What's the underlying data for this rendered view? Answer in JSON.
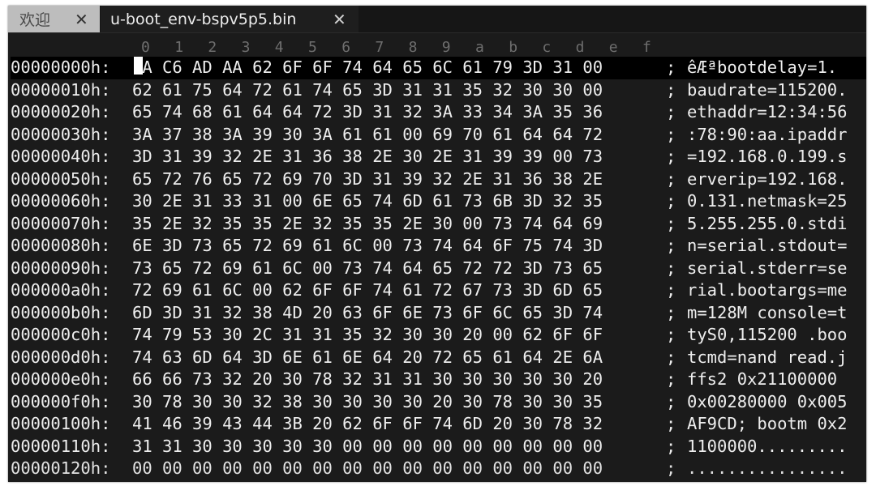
{
  "tabs": [
    {
      "label": "欢迎",
      "close": "✕"
    },
    {
      "label": "u-boot_env-bspv5p5.bin",
      "close": "✕"
    }
  ],
  "ruler": [
    "0",
    "1",
    "2",
    "3",
    "4",
    "5",
    "6",
    "7",
    "8",
    "9",
    "a",
    "b",
    "c",
    "d",
    "e",
    "f"
  ],
  "rows": [
    {
      "offset": "00000000h:",
      "hex": " A C6 AD AA 62 6F 6F 74 64 65 6C 61 79 3D 31 00",
      "sep": ";",
      "ascii": "êÆªbootdelay=1."
    },
    {
      "offset": "00000010h:",
      "hex": "62 61 75 64 72 61 74 65 3D 31 31 35 32 30 30 00",
      "sep": ";",
      "ascii": "baudrate=115200."
    },
    {
      "offset": "00000020h:",
      "hex": "65 74 68 61 64 64 72 3D 31 32 3A 33 34 3A 35 36",
      "sep": ";",
      "ascii": "ethaddr=12:34:56"
    },
    {
      "offset": "00000030h:",
      "hex": "3A 37 38 3A 39 30 3A 61 61 00 69 70 61 64 64 72",
      "sep": ";",
      "ascii": ":78:90:aa.ipaddr"
    },
    {
      "offset": "00000040h:",
      "hex": "3D 31 39 32 2E 31 36 38 2E 30 2E 31 39 39 00 73",
      "sep": ";",
      "ascii": "=192.168.0.199.s"
    },
    {
      "offset": "00000050h:",
      "hex": "65 72 76 65 72 69 70 3D 31 39 32 2E 31 36 38 2E",
      "sep": ";",
      "ascii": "erverip=192.168."
    },
    {
      "offset": "00000060h:",
      "hex": "30 2E 31 33 31 00 6E 65 74 6D 61 73 6B 3D 32 35",
      "sep": ";",
      "ascii": "0.131.netmask=25"
    },
    {
      "offset": "00000070h:",
      "hex": "35 2E 32 35 35 2E 32 35 35 2E 30 00 73 74 64 69",
      "sep": ";",
      "ascii": "5.255.255.0.stdi"
    },
    {
      "offset": "00000080h:",
      "hex": "6E 3D 73 65 72 69 61 6C 00 73 74 64 6F 75 74 3D",
      "sep": ";",
      "ascii": "n=serial.stdout="
    },
    {
      "offset": "00000090h:",
      "hex": "73 65 72 69 61 6C 00 73 74 64 65 72 72 3D 73 65",
      "sep": ";",
      "ascii": "serial.stderr=se"
    },
    {
      "offset": "000000a0h:",
      "hex": "72 69 61 6C 00 62 6F 6F 74 61 72 67 73 3D 6D 65",
      "sep": ";",
      "ascii": "rial.bootargs=me"
    },
    {
      "offset": "000000b0h:",
      "hex": "6D 3D 31 32 38 4D 20 63 6F 6E 73 6F 6C 65 3D 74",
      "sep": ";",
      "ascii": "m=128M console=t"
    },
    {
      "offset": "000000c0h:",
      "hex": "74 79 53 30 2C 31 31 35 32 30 30 20 00 62 6F 6F",
      "sep": ";",
      "ascii": "tyS0,115200 .boo"
    },
    {
      "offset": "000000d0h:",
      "hex": "74 63 6D 64 3D 6E 61 6E 64 20 72 65 61 64 2E 6A",
      "sep": ";",
      "ascii": "tcmd=nand read.j"
    },
    {
      "offset": "000000e0h:",
      "hex": "66 66 73 32 20 30 78 32 31 31 30 30 30 30 30 20",
      "sep": ";",
      "ascii": "ffs2 0x21100000 "
    },
    {
      "offset": "000000f0h:",
      "hex": "30 78 30 30 32 38 30 30 30 30 20 30 78 30 30 35",
      "sep": ";",
      "ascii": "0x00280000 0x005"
    },
    {
      "offset": "00000100h:",
      "hex": "41 46 39 43 44 3B 20 62 6F 6F 74 6D 20 30 78 32",
      "sep": ";",
      "ascii": "AF9CD; bootm 0x2"
    },
    {
      "offset": "00000110h:",
      "hex": "31 31 30 30 30 30 30 00 00 00 00 00 00 00 00 00",
      "sep": ";",
      "ascii": "1100000........."
    },
    {
      "offset": "00000120h:",
      "hex": "00 00 00 00 00 00 00 00 00 00 00 00 00 00 00 00",
      "sep": ";",
      "ascii": "................"
    }
  ]
}
